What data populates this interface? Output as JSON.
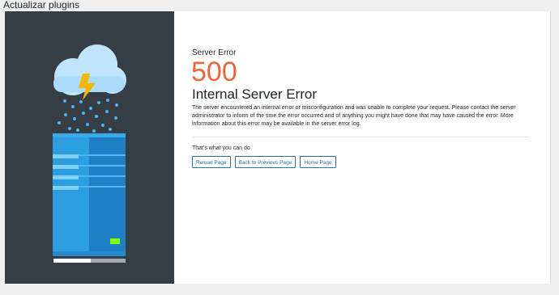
{
  "window": {
    "title": "Actualizar plugins"
  },
  "error": {
    "label": "Server Error",
    "code": "500",
    "title": "Internal Server Error",
    "description": "The server encountered an internal error or misconfiguration and was unable to complete your request. Please contact the server administrator to inform of the time the error occurred and of anything you might have done that may have caused the error. More information about this error may be available in the server error log."
  },
  "actions": {
    "label": "That's what you can do",
    "reload": "Reload Page",
    "back": "Back to Previous Page",
    "home": "Home Page"
  },
  "colors": {
    "accent": "#f0643c",
    "link": "#2271b1",
    "panel": "#353e45",
    "server_light": "#2b9ee0",
    "server_dark": "#1f80c5",
    "bolt": "#f5b800",
    "led": "#7fff00"
  },
  "illustration": {
    "icons": [
      "cloud-icon",
      "lightning-bolt-icon",
      "rain-drops",
      "server-icon",
      "status-led"
    ]
  }
}
